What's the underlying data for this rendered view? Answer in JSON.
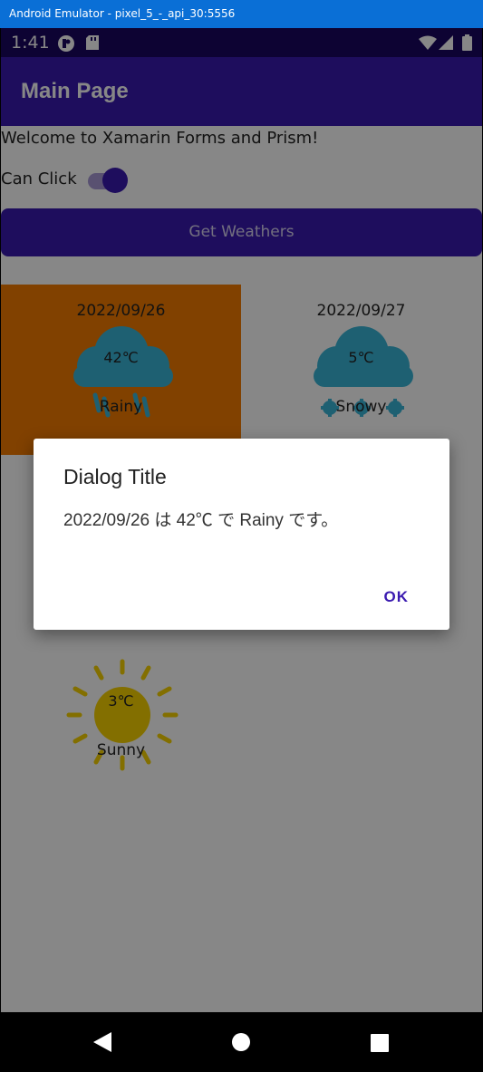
{
  "emulator": {
    "title": "Android Emulator - pixel_5_-_api_30:5556"
  },
  "status_bar": {
    "time": "1:41"
  },
  "app_bar": {
    "title": "Main Page"
  },
  "main": {
    "welcome_text": "Welcome to Xamarin Forms and Prism!",
    "can_click_label": "Can Click",
    "can_click_on": true,
    "get_weathers_label": "Get Weathers"
  },
  "weathers": [
    {
      "date": "2022/09/26",
      "temp": "42℃",
      "condition": "Rainy",
      "icon": "rain-cloud-icon",
      "highlighted": true
    },
    {
      "date": "2022/09/27",
      "temp": "5℃",
      "condition": "Snowy",
      "icon": "snow-cloud-icon",
      "highlighted": false
    },
    {
      "date": "",
      "temp": "3℃",
      "condition": "Sunny",
      "icon": "sun-icon",
      "highlighted": false
    }
  ],
  "dialog": {
    "title": "Dialog Title",
    "message": "2022/09/26 は 42℃ で Rainy です。",
    "ok_label": "OK"
  },
  "colors": {
    "primary": "#3a1ab0",
    "highlight": "#f47c00",
    "cloud": "#3ab5d8",
    "sun": "#f7d200"
  }
}
